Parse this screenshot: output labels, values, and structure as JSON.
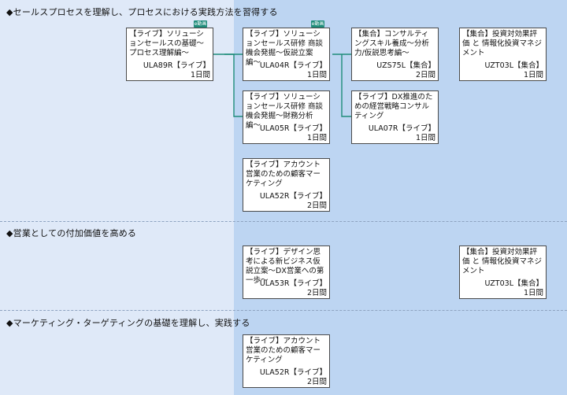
{
  "sections": [
    {
      "title": "◆セールスプロセスを理解し、プロセスにおける実践方法を習得する"
    },
    {
      "title": "◆営業としての付加価値を高める"
    },
    {
      "title": "◆マーケティング・ターゲティングの基礎を理解し、実践する"
    }
  ],
  "badge_label": "e動画",
  "courses": [
    {
      "title": "【ライブ】ソリューションセールスの基礎〜プロセス理解編〜",
      "code": "ULA89R【ライブ】",
      "duration": "1日間"
    },
    {
      "title": "【ライブ】ソリューションセールス研修 商談機会発掘〜仮説立案編〜",
      "code": "ULA04R【ライブ】",
      "duration": "1日間"
    },
    {
      "title": "【集合】コンサルティングスキル養成〜分析力/仮説思考編〜",
      "code": "UZS75L【集合】",
      "duration": "2日間"
    },
    {
      "title": "【集合】投資対効果評価 と 情報化投資マネジメント",
      "code": "UZT03L【集合】",
      "duration": "1日間"
    },
    {
      "title": "【ライブ】ソリューションセールス研修 商談機会発掘〜財務分析編〜",
      "code": "ULA05R【ライブ】",
      "duration": "1日間"
    },
    {
      "title": "【ライブ】DX推進のための経営戦略コンサルティング",
      "code": "ULA07R【ライブ】",
      "duration": "1日間"
    },
    {
      "title": "【ライブ】アカウント営業のための顧客マーケティング",
      "code": "ULA52R【ライブ】",
      "duration": "2日間"
    },
    {
      "title": "【ライブ】デザイン思考による新ビジネス仮説立案〜DX営業への第一歩〜",
      "code": "ULA53R【ライブ】",
      "duration": "2日間"
    },
    {
      "title": "【集合】投資対効果評価 と 情報化投資マネジメント",
      "code": "UZT03L【集合】",
      "duration": "1日間"
    },
    {
      "title": "【ライブ】アカウント営業のための顧客マーケティング",
      "code": "ULA52R【ライブ】",
      "duration": "2日間"
    }
  ]
}
